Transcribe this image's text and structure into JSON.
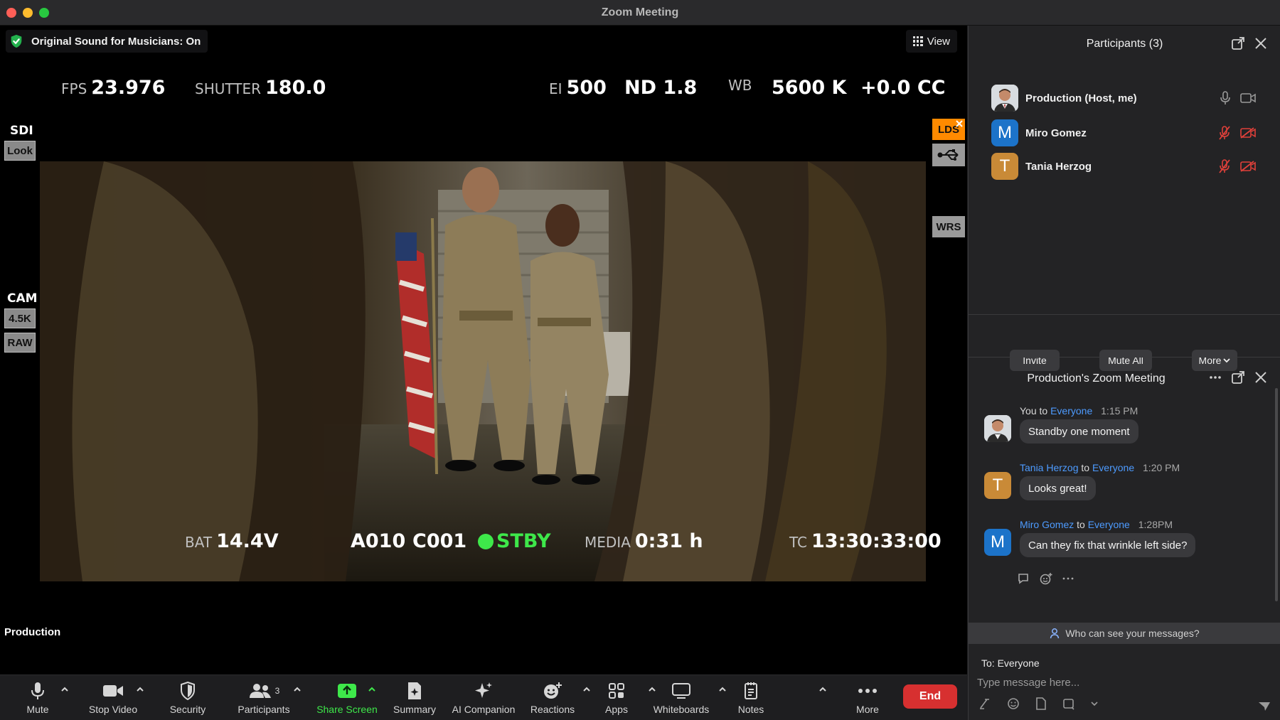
{
  "window": {
    "title": "Zoom Meeting"
  },
  "stage": {
    "sound_badge": "Original Sound for Musicians: On",
    "view_label": "View",
    "participant_label": "Production"
  },
  "hud_top": {
    "fps_label": "FPS",
    "fps_value": "23.976",
    "shutter_label": "SHUTTER",
    "shutter_value": "180.0",
    "ei_label": "EI",
    "ei_value": "500",
    "nd_value": "ND 1.8",
    "wb_label": "WB",
    "wb_value": "5600 K",
    "cc_value": "+0.0 CC"
  },
  "hud_bottom": {
    "bat_label": "BAT",
    "bat_value": "14.4V",
    "reel": "A010",
    "clip": "C001",
    "state": "STBY",
    "media_label": "MEDIA",
    "media_value": "0:31 h",
    "tc_label": "TC",
    "tc_value": "13:30:33:00"
  },
  "hud_side": {
    "sdi": "SDI",
    "look": "Look",
    "cam": "CAM",
    "res": "4.5K",
    "raw": "RAW",
    "lds": "LDS",
    "wrs": "WRS"
  },
  "toolbar": {
    "mute": "Mute",
    "stop_video": "Stop Video",
    "security": "Security",
    "participants": "Participants",
    "participants_count": "3",
    "share_screen": "Share Screen",
    "summary": "Summary",
    "ai_companion": "AI Companion",
    "reactions": "Reactions",
    "apps": "Apps",
    "whiteboards": "Whiteboards",
    "notes": "Notes",
    "more": "More",
    "end": "End"
  },
  "participants_panel": {
    "title": "Participants (3)",
    "people": [
      {
        "name": "Production (Host, me)",
        "initial": "",
        "muted": false
      },
      {
        "name": "Miro Gomez",
        "initial": "M",
        "muted": true
      },
      {
        "name": "Tania Herzog",
        "initial": "T",
        "muted": true
      }
    ],
    "invite": "Invite",
    "mute_all": "Mute All",
    "more": "More"
  },
  "chat": {
    "title": "Production's Zoom Meeting",
    "messages": [
      {
        "from": "You",
        "to": "to",
        "audience": "Everyone",
        "time": "1:15 PM",
        "text": "Standby one moment"
      },
      {
        "from": "Tania Herzog",
        "to": "to",
        "audience": "Everyone",
        "time": "1:20 PM",
        "text": "Looks great!"
      },
      {
        "from": "Miro Gomez",
        "to": "to",
        "audience": "Everyone",
        "time": "1:28PM",
        "text": "Can they fix that wrinkle left side?"
      }
    ],
    "who_can_see": "Who can see your messages?",
    "to_line": "To: Everyone",
    "placeholder": "Type message here..."
  },
  "colors": {
    "accent_green": "#3ee84a",
    "lds_orange": "#ff8a00",
    "end_red": "#d73030",
    "link_blue": "#4d9bff"
  }
}
